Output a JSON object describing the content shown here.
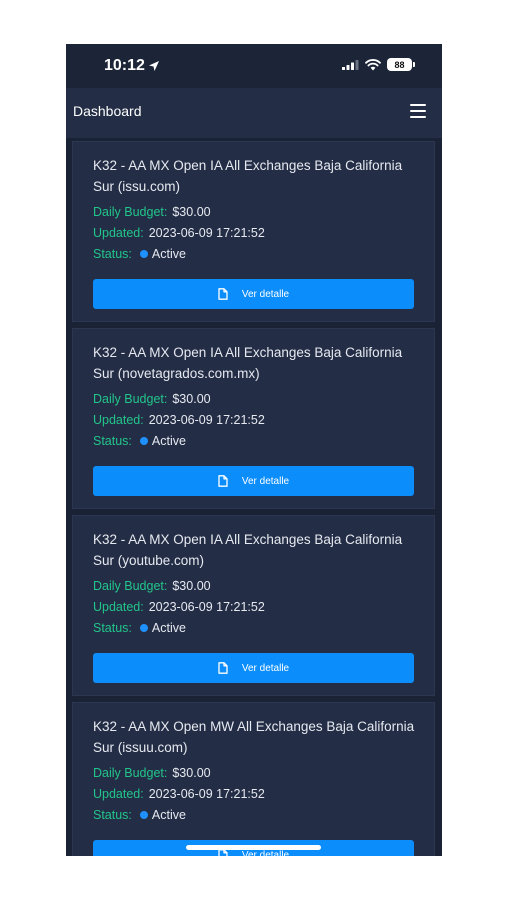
{
  "status_bar": {
    "time": "10:12",
    "battery": "88"
  },
  "header": {
    "title": "Dashboard"
  },
  "labels": {
    "daily_budget": "Daily Budget:",
    "updated": "Updated:",
    "status": "Status:"
  },
  "button_label": "Ver detalle",
  "cards": [
    {
      "title": "K32 - AA MX Open IA All Exchanges Baja California Sur (issu.com)",
      "daily_budget": "$30.00",
      "updated": "2023-06-09 17:21:52",
      "status": "Active"
    },
    {
      "title": "K32 - AA MX Open IA All Exchanges Baja California Sur (novetagrados.com.mx)",
      "daily_budget": "$30.00",
      "updated": "2023-06-09 17:21:52",
      "status": "Active"
    },
    {
      "title": "K32 - AA MX Open IA All Exchanges Baja California Sur (youtube.com)",
      "daily_budget": "$30.00",
      "updated": "2023-06-09 17:21:52",
      "status": "Active"
    },
    {
      "title": "K32 - AA MX Open MW All Exchanges Baja California Sur (issuu.com)",
      "daily_budget": "$30.00",
      "updated": "2023-06-09 17:21:52",
      "status": "Active"
    }
  ],
  "colors": {
    "background": "#1a2236",
    "card": "#232d45",
    "label": "#22c58b",
    "accent": "#0b8dfb",
    "status_active": "#1e90ff"
  },
  "icons": {
    "location": "location-arrow-icon",
    "signal": "signal-icon",
    "wifi": "wifi-icon",
    "battery": "battery-icon",
    "menu": "hamburger-menu-icon",
    "document": "document-icon"
  }
}
